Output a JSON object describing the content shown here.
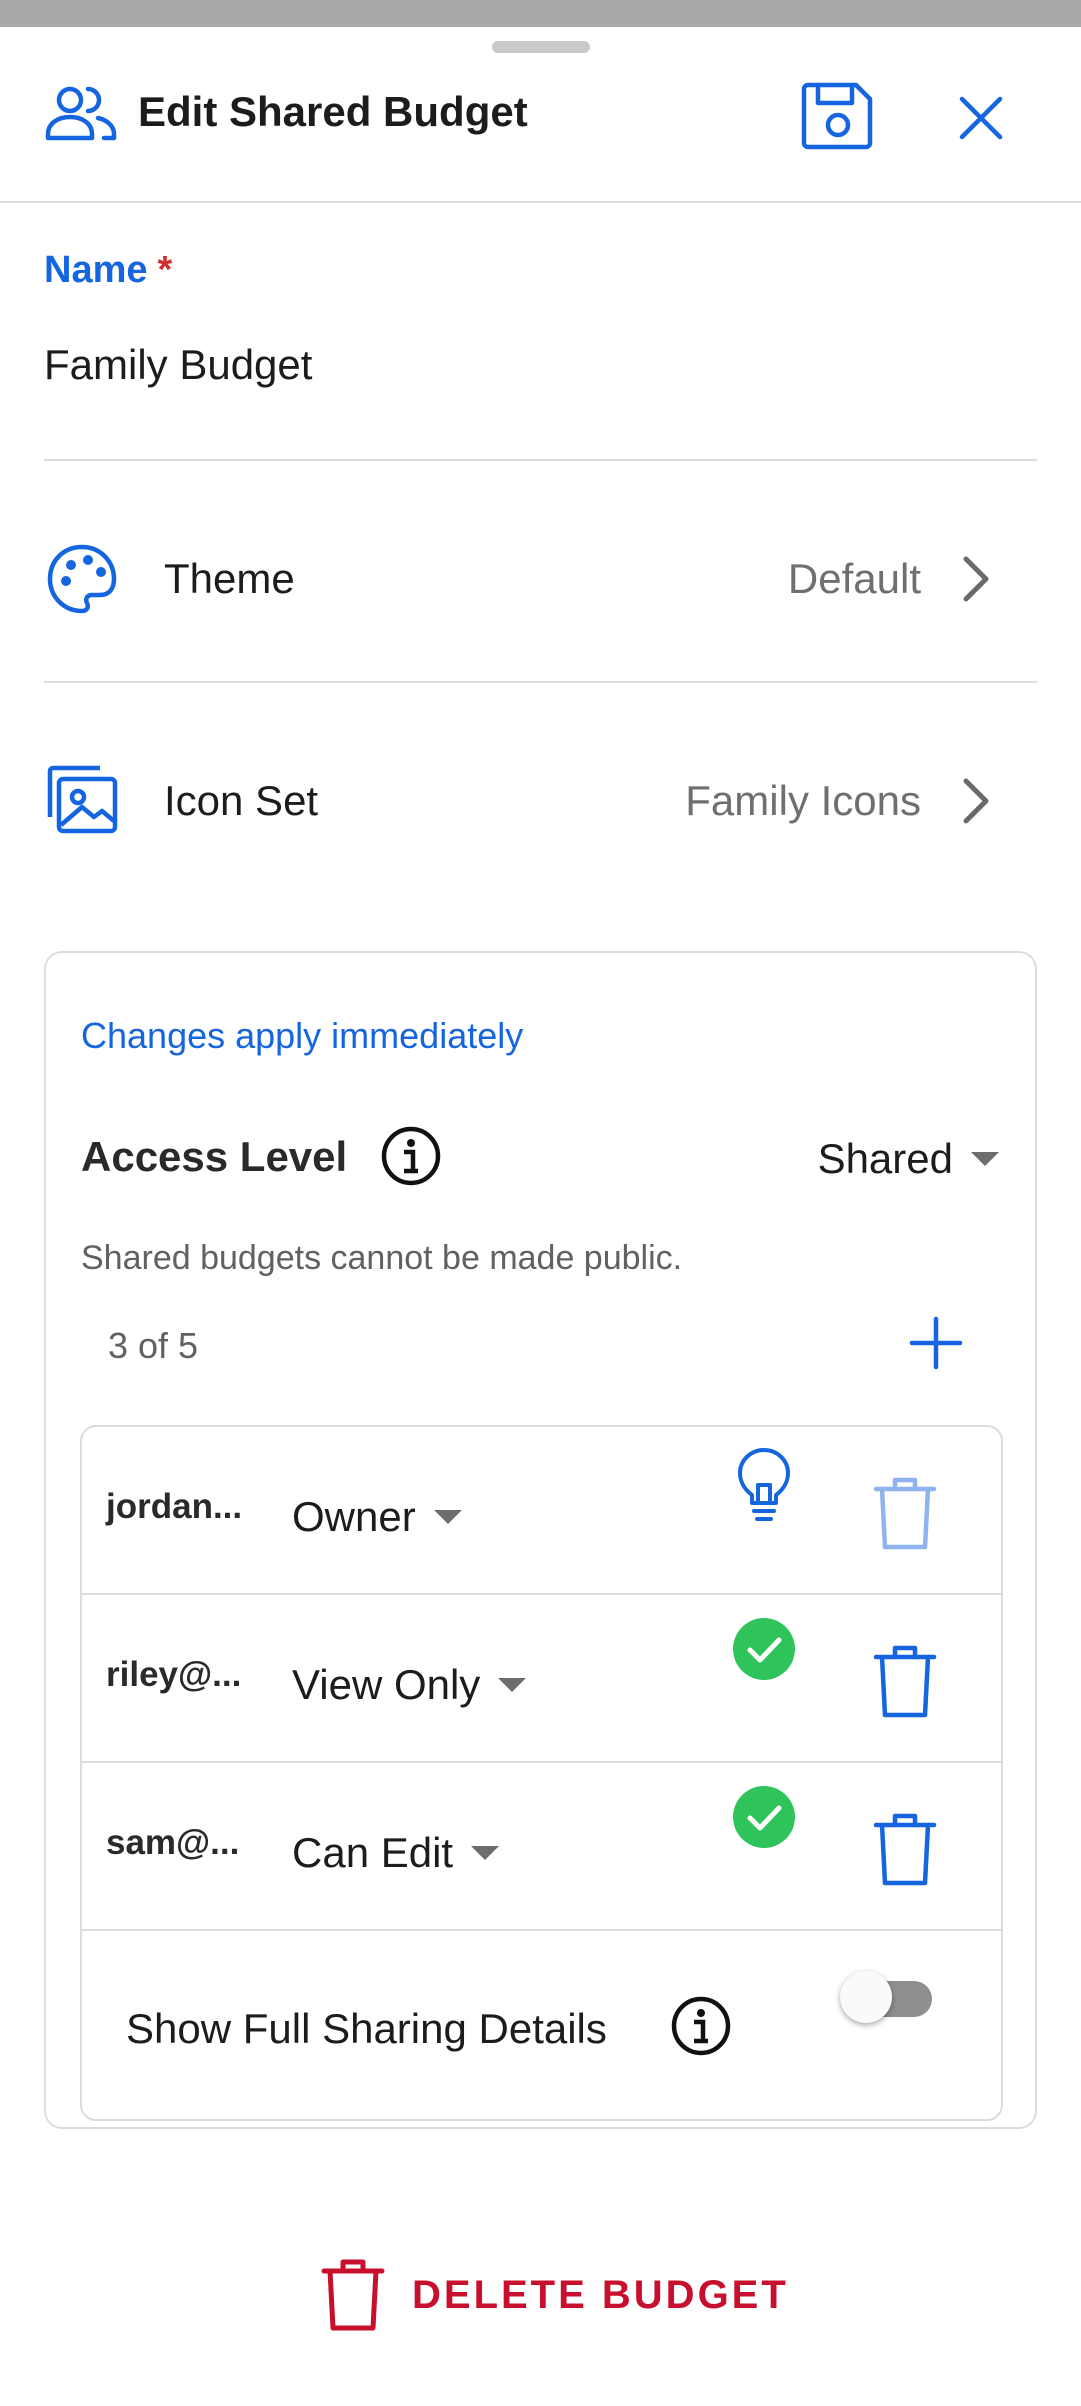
{
  "header": {
    "title": "Edit Shared Budget",
    "icon": "people-icon",
    "save_icon": "save-icon",
    "close_icon": "close-icon"
  },
  "name_field": {
    "label": "Name",
    "required_mark": "*",
    "value": "Family Budget"
  },
  "rows": [
    {
      "label": "Theme",
      "value": "Default",
      "icon": "palette-icon"
    },
    {
      "label": "Icon Set",
      "value": "Family Icons",
      "icon": "image-gallery-icon"
    }
  ],
  "sharing": {
    "notice": "Changes apply immediately",
    "access_label": "Access Level",
    "access_value": "Shared",
    "access_hint": "Shared budgets cannot be made public.",
    "member_count": "3 of 5",
    "members": [
      {
        "email": "jordan...",
        "role": "Owner",
        "status_icon": "lightbulb-icon",
        "delete_enabled": false
      },
      {
        "email": "riley@...",
        "role": "View Only",
        "status_icon": "check-circle-icon",
        "delete_enabled": true
      },
      {
        "email": "sam@...",
        "role": "Can Edit",
        "status_icon": "check-circle-icon",
        "delete_enabled": true
      }
    ],
    "details_label": "Show Full Sharing Details",
    "details_toggle_on": false
  },
  "delete_label": "DELETE BUDGET",
  "colors": {
    "accent": "#1565e0",
    "danger": "#c8102e",
    "success": "#2ec45a",
    "disabled_icon": "#8fb3ef"
  }
}
